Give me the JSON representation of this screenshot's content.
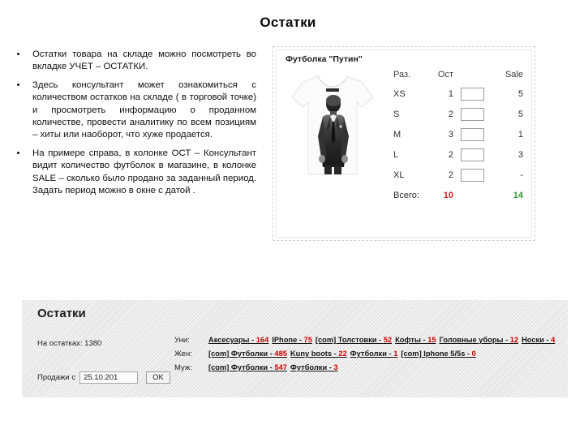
{
  "slide": {
    "title": "Остатки"
  },
  "bullets": [
    {
      "text": "Остатки товара на складе можно посмотреть во вкладке УЧЕТ – ОСТАТКИ."
    },
    {
      "text": "Здесь консультант может ознакомиться с количеством остатков на складе ( в торговой точке) и просмотреть информацию о проданном количестве, провести аналитику по всем позициям – хиты или наоборот, что хуже продается."
    },
    {
      "text": "На примере справа, в колонке ОСТ – Консультант видит количество футболок в магазине, в колонке SALE – сколько было продано за заданный период. Задать период можно в окне с датой ."
    }
  ],
  "card": {
    "title": "Футболка \"Путин\"",
    "product_image_alt": "t-shirt-with-portrait-print",
    "table": {
      "headers": [
        "Раз.",
        "Ост",
        "",
        "Sale"
      ],
      "rows": [
        {
          "size": "XS",
          "ost": "1",
          "box": "",
          "sale": "5"
        },
        {
          "size": "S",
          "ost": "2",
          "box": "",
          "sale": "5"
        },
        {
          "size": "M",
          "ost": "3",
          "box": "",
          "sale": "1"
        },
        {
          "size": "L",
          "ost": "2",
          "box": "",
          "sale": "3"
        },
        {
          "size": "XL",
          "ost": "2",
          "box": "",
          "sale": "-"
        }
      ],
      "total_label": "Всего:",
      "total_ost": "10",
      "total_sale": "14",
      "total_ost_color": "#cc2222",
      "total_sale_color": "#3a9a3a"
    }
  },
  "bottom_panel": {
    "title": "Остатки",
    "remains_label": "На остатках: 1380",
    "sales_from_label": "Продажи с",
    "date_value": "25.10.201",
    "ok_label": "OK",
    "accent_number_color": "#cc0000",
    "categories": [
      {
        "label": "Уни:",
        "items": [
          {
            "name": "Аксесуары",
            "count": "164"
          },
          {
            "name": "IPhone",
            "count": "75"
          },
          {
            "name": "[com] Толстовки",
            "count": "52"
          },
          {
            "name": "Кофты",
            "count": "15"
          },
          {
            "name": "Головные уборы",
            "count": "12"
          },
          {
            "name": "Носки",
            "count": "4"
          }
        ]
      },
      {
        "label": "Жен:",
        "items": [
          {
            "name": "[com] Футболки",
            "count": "485"
          },
          {
            "name": "Kuny boots",
            "count": "22"
          },
          {
            "name": "Футболки",
            "count": "1"
          },
          {
            "name": "[com] Iphone 5/5s",
            "count": "0"
          }
        ]
      },
      {
        "label": "Муж:",
        "items": [
          {
            "name": "[com] Футболки",
            "count": "547"
          },
          {
            "name": "Футболки",
            "count": "3"
          }
        ]
      }
    ]
  }
}
